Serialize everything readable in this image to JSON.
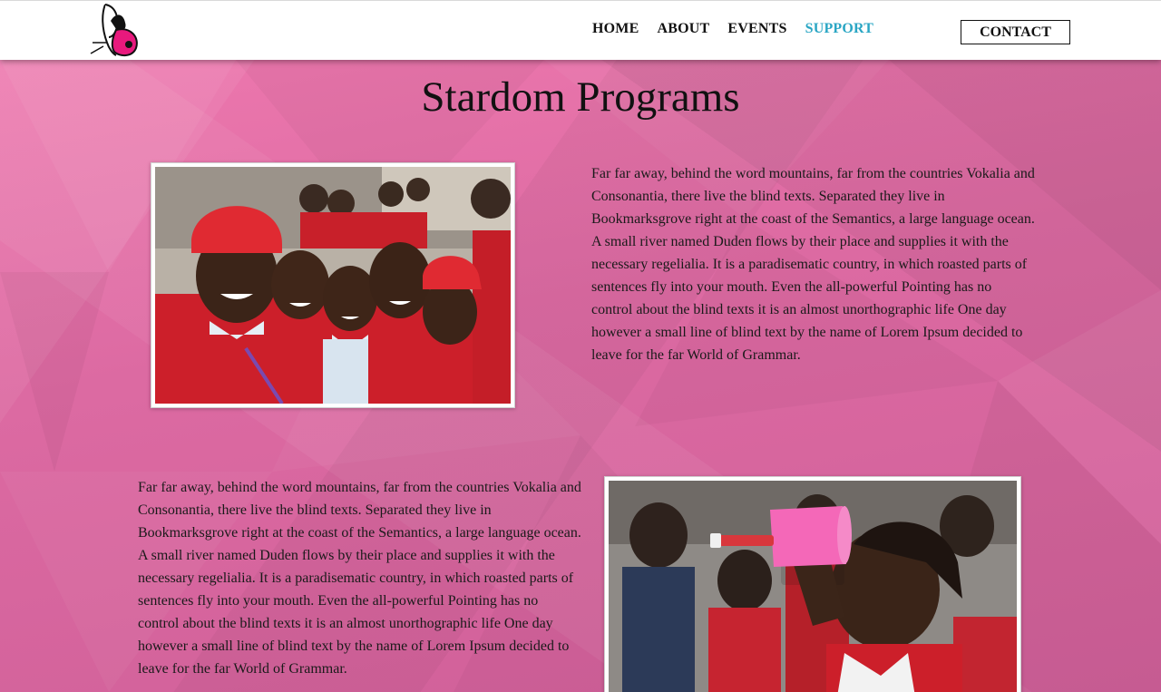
{
  "header": {
    "logo_name": "butterfly-logo",
    "nav": [
      {
        "label": "HOME",
        "active": false
      },
      {
        "label": "ABOUT",
        "active": false
      },
      {
        "label": "EVENTS",
        "active": false
      },
      {
        "label": "SUPPORT",
        "active": true
      }
    ],
    "contact_label": "CONTACT",
    "active_color": "#2aa6c4"
  },
  "main": {
    "title": "Stardom Programs",
    "sections": [
      {
        "image_subject": "group of smiling schoolchildren in red uniforms",
        "text": "Far far away, behind the word mountains, far from the countries Vokalia and Consonantia, there live the blind texts. Separated they live in Bookmarksgrove right at the coast of the Semantics, a large language ocean. A small river named Duden flows by their place and supplies it with the necessary regelialia. It is a paradisematic country, in which roasted parts of sentences fly into your mouth. Even the all-powerful Pointing has no control about the blind texts it is an almost unorthographic life One day however a small line of blind text by the name of Lorem Ipsum decided to leave for the far World of Grammar."
      },
      {
        "image_subject": "girl drinking water from a pink cup",
        "text": "Far far away, behind the word mountains, far from the countries Vokalia and Consonantia, there live the blind texts. Separated they live in Bookmarksgrove right at the coast of the Semantics, a large language ocean. A small river named Duden flows by their place and supplies it with the necessary regelialia. It is a paradisematic country, in which roasted parts of sentences fly into your mouth. Even the all-powerful Pointing has no control about the blind texts it is an almost unorthographic life One day however a small line of blind text by the name of Lorem Ipsum decided to leave for the far World of Grammar."
      }
    ]
  },
  "colors": {
    "background": "#e471a6",
    "header": "#ffffff",
    "brand_pink": "#e8197d"
  }
}
